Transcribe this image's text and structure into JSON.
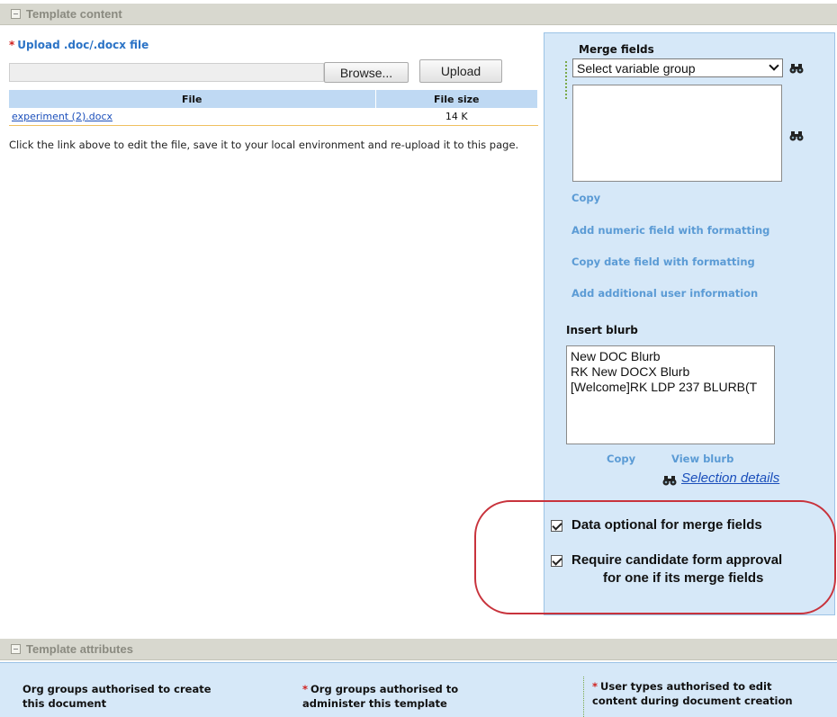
{
  "colors": {
    "panel_blue": "#d6e8f8",
    "link_blue": "#5b9bd5",
    "required_red": "#d0201d",
    "highlight_ellipse": "#c8333c"
  },
  "template_content": {
    "section_title": "Template content",
    "upload_label": "Upload .doc/.docx file",
    "required_mark": "*",
    "browse_label": "Browse...",
    "upload_button": "Upload",
    "table": {
      "headers": [
        "File",
        "File size"
      ],
      "rows": [
        {
          "file": "experiment (2).docx",
          "size": "14 K"
        }
      ]
    },
    "help_text": "Click the link above to edit the file, save it to your local environment and re-upload it to this page."
  },
  "merge_fields": {
    "title": "Merge fields",
    "select_value": "Select variable group",
    "links": {
      "copy": "Copy",
      "add_numeric": "Add numeric field with formatting",
      "copy_date": "Copy date field with formatting",
      "add_user_info": "Add additional user information"
    }
  },
  "insert_blurb": {
    "title": "Insert blurb",
    "items": [
      "New DOC Blurb",
      "RK New DOCX Blurb",
      "[Welcome]RK LDP 237 BLURB(T"
    ],
    "copy": "Copy",
    "view": "View blurb",
    "selection_details": "Selection details"
  },
  "options": {
    "data_optional": {
      "label": "Data optional for merge fields",
      "checked": true
    },
    "require_approval": {
      "label_line1": "Require candidate form approval",
      "label_line2": "for one if its merge fields",
      "checked": true
    }
  },
  "template_attributes": {
    "section_title": "Template attributes",
    "col1": {
      "line1": "Org groups authorised to create",
      "line2": "this document"
    },
    "col2": {
      "req": "*",
      "line1": "Org groups authorised to",
      "line2": "administer this template"
    },
    "col3": {
      "req": "*",
      "line1": "User types authorised to edit",
      "line2": "content during document creation"
    }
  },
  "icons": {
    "lookup": "binoculars-icon",
    "collapse": "collapse-icon",
    "checkbox": "checkbox-checked-icon"
  }
}
